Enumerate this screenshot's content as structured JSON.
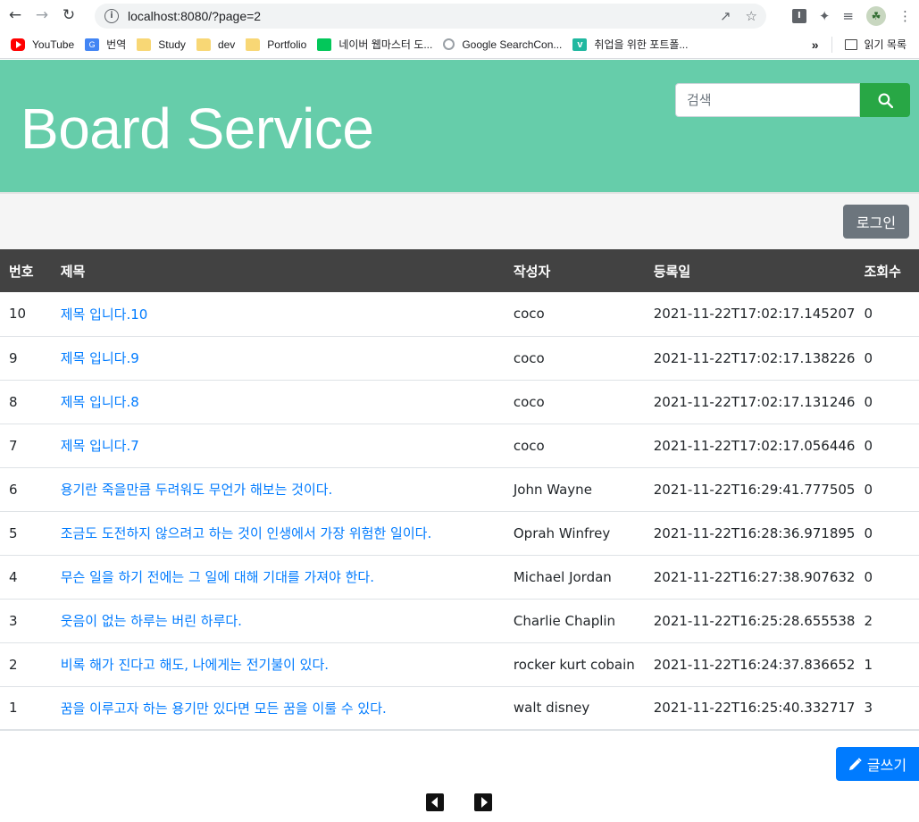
{
  "browser": {
    "url": "localhost:8080/?page=2",
    "bookmarks": [
      {
        "label": "YouTube",
        "icon": "youtube-icon"
      },
      {
        "label": "번역",
        "icon": "translate-icon"
      },
      {
        "label": "Study",
        "icon": "folder-icon"
      },
      {
        "label": "dev",
        "icon": "folder-icon"
      },
      {
        "label": "Portfolio",
        "icon": "folder-icon"
      },
      {
        "label": "네이버 웹마스터 도...",
        "icon": "naver-icon"
      },
      {
        "label": "Google SearchCon...",
        "icon": "search-console-icon"
      },
      {
        "label": "취업을 위한 포트폴...",
        "icon": "vimeo-icon"
      }
    ],
    "more_label": "»",
    "reading_list_label": "읽기 목록"
  },
  "hero": {
    "title": "Board Service",
    "search_placeholder": "검색"
  },
  "bar": {
    "login_label": "로그인"
  },
  "table": {
    "headers": [
      "번호",
      "제목",
      "작성자",
      "등록일",
      "조회수"
    ],
    "rows": [
      {
        "no": "10",
        "title": "제목 입니다.10",
        "author": "coco",
        "date": "2021-11-22T17:02:17.145207",
        "views": "0"
      },
      {
        "no": "9",
        "title": "제목 입니다.9",
        "author": "coco",
        "date": "2021-11-22T17:02:17.138226",
        "views": "0"
      },
      {
        "no": "8",
        "title": "제목 입니다.8",
        "author": "coco",
        "date": "2021-11-22T17:02:17.131246",
        "views": "0"
      },
      {
        "no": "7",
        "title": "제목 입니다.7",
        "author": "coco",
        "date": "2021-11-22T17:02:17.056446",
        "views": "0"
      },
      {
        "no": "6",
        "title": "용기란 죽을만큼 두려워도 무언가 해보는 것이다.",
        "author": "John Wayne",
        "date": "2021-11-22T16:29:41.777505",
        "views": "0"
      },
      {
        "no": "5",
        "title": "조금도 도전하지 않으려고 하는 것이 인생에서 가장 위험한 일이다.",
        "author": "Oprah Winfrey",
        "date": "2021-11-22T16:28:36.971895",
        "views": "0"
      },
      {
        "no": "4",
        "title": "무슨 일을 하기 전에는 그 일에 대해 기대를 가져야 한다.",
        "author": "Michael Jordan",
        "date": "2021-11-22T16:27:38.907632",
        "views": "0"
      },
      {
        "no": "3",
        "title": "웃음이 없는 하루는 버린 하루다.",
        "author": "Charlie Chaplin",
        "date": "2021-11-22T16:25:28.655538",
        "views": "2"
      },
      {
        "no": "2",
        "title": "비록 해가 진다고 해도, 나에게는 전기불이 있다.",
        "author": "rocker kurt cobain",
        "date": "2021-11-22T16:24:37.836652",
        "views": "1"
      },
      {
        "no": "1",
        "title": "꿈을 이루고자 하는 용기만 있다면 모든 꿈을 이룰 수 있다.",
        "author": "walt disney",
        "date": "2021-11-22T16:25:40.332717",
        "views": "3"
      }
    ]
  },
  "write_label": "글쓰기",
  "colors": {
    "hero_bg": "#66cdaa",
    "header_row_bg": "#424242",
    "link": "#007bff",
    "search_button": "#28a745",
    "login_button": "#6c757d",
    "write_button": "#007bff"
  }
}
